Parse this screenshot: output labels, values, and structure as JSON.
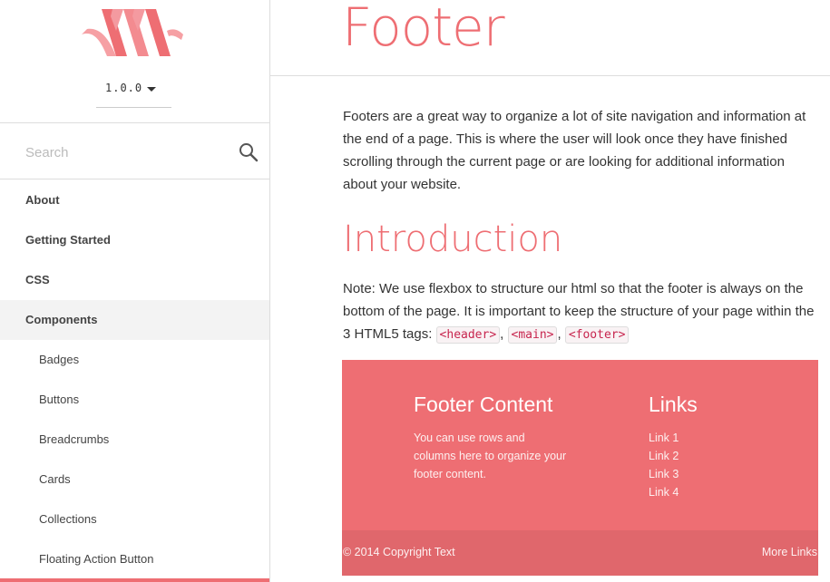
{
  "sidebar": {
    "version": "1.0.0",
    "search_placeholder": "Search",
    "items": [
      {
        "label": "About"
      },
      {
        "label": "Getting Started"
      },
      {
        "label": "CSS"
      },
      {
        "label": "Components"
      }
    ],
    "sub_items": [
      {
        "label": "Badges"
      },
      {
        "label": "Buttons"
      },
      {
        "label": "Breadcrumbs"
      },
      {
        "label": "Cards"
      },
      {
        "label": "Collections"
      },
      {
        "label": "Floating Action Button"
      }
    ]
  },
  "header": {
    "title": "Footer"
  },
  "main": {
    "intro": "Footers are a great way to organize a lot of site navigation and information at the end of a page. This is where the user will look once they have finished scrolling through the current page or are looking for additional information about your website.",
    "section_title": "Introduction",
    "note_text": "Note: We use flexbox to structure our html so that the footer is always on the bottom of the page. It is important to keep the structure of your page within the 3 HTML5 tags: ",
    "tags": [
      "<header>",
      "<main>",
      "<footer>"
    ],
    "tag_sep": ", "
  },
  "footer_demo": {
    "title": "Footer Content",
    "text": "You can use rows and columns here to organize your footer content.",
    "links_title": "Links",
    "links": [
      "Link 1",
      "Link 2",
      "Link 3",
      "Link 4"
    ],
    "copyright": "© 2014 Copyright Text",
    "more_links": "More Links"
  },
  "colors": {
    "accent": "#ee6e73",
    "footer_copy_bg": "#e0676c",
    "active_nav_bg": "#f3f3f3"
  }
}
